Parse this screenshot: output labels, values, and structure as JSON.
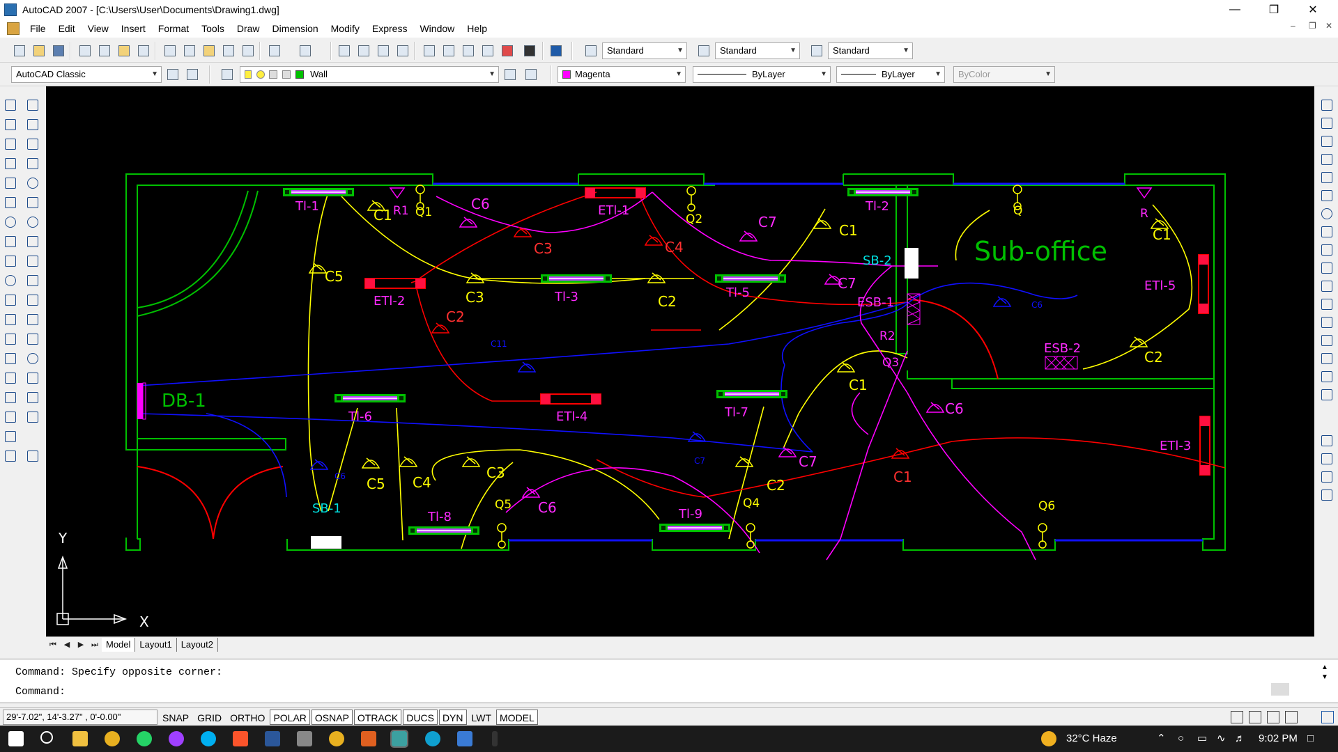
{
  "window": {
    "title": "AutoCAD 2007 - [C:\\Users\\User\\Documents\\Drawing1.dwg]",
    "minimize": "—",
    "restore": "❐",
    "close": "✕"
  },
  "menu": [
    "File",
    "Edit",
    "View",
    "Insert",
    "Format",
    "Tools",
    "Draw",
    "Dimension",
    "Modify",
    "Express",
    "Window",
    "Help"
  ],
  "toolbar1": {
    "text_style": "Standard",
    "dim_style": "Standard",
    "table_style": "Standard"
  },
  "toolbar2": {
    "workspace": "AutoCAD Classic",
    "layer": "Wall",
    "color": "Magenta",
    "linetype": "ByLayer",
    "lineweight": "ByLayer",
    "plotstyle": "ByColor"
  },
  "colors": {
    "wall": "#00c000",
    "yellow_wire": "#ffff00",
    "red_wire": "#ff0000",
    "blue_wire": "#1010ff",
    "magenta_wire": "#ff00ff",
    "label_magenta": "#ff2aff",
    "label_yellow": "#ffff00",
    "label_red": "#ff3030",
    "label_green": "#00c000",
    "label_cyan": "#00e0e0",
    "tube_body": "#c040ff",
    "canvas_bg": "#000000"
  },
  "drawing": {
    "room_label": "Sub-office",
    "db_label": "DB-1",
    "tubelights": [
      "Tl-1",
      "Tl-2",
      "Tl-3",
      "Tl-5",
      "Tl-6",
      "Tl-7",
      "Tl-8",
      "Tl-9"
    ],
    "etl_labels": [
      "ETl-1",
      "ETl-2",
      "ETl-3",
      "ETl-4",
      "ETl-5"
    ],
    "switchboards": [
      "SB-1",
      "SB-2"
    ],
    "esb_labels": [
      "ESB-1",
      "ESB-2"
    ],
    "q_labels": [
      "Q1",
      "Q2",
      "Q",
      "Q3",
      "Q4",
      "Q5",
      "Q6"
    ],
    "r_labels": [
      "R1",
      "R",
      "R2"
    ],
    "c_yellow": [
      "C1",
      "C1",
      "C1",
      "C1",
      "C2",
      "C2",
      "C2",
      "C3",
      "C3",
      "C4",
      "C5",
      "C5"
    ],
    "c_magenta": [
      "C6",
      "C7",
      "C7",
      "C6",
      "C6",
      "C7"
    ],
    "c_red": [
      "C2",
      "C3",
      "C4",
      "C1"
    ],
    "c_blue": [
      "C6",
      "C6",
      "C7",
      "C11"
    ]
  },
  "ucs": {
    "x": "X",
    "y": "Y"
  },
  "layout_tabs": [
    "Model",
    "Layout1",
    "Layout2"
  ],
  "layout_nav": [
    "⏮",
    "◀",
    "▶",
    "⏭"
  ],
  "command": {
    "history": "Command: Specify opposite corner:",
    "prompt": "Command:"
  },
  "status": {
    "coords": "29'-7.02\", 14'-3.27\" , 0'-0.00\"",
    "buttons": [
      {
        "label": "SNAP",
        "on": false
      },
      {
        "label": "GRID",
        "on": false
      },
      {
        "label": "ORTHO",
        "on": false
      },
      {
        "label": "POLAR",
        "on": true
      },
      {
        "label": "OSNAP",
        "on": true
      },
      {
        "label": "OTRACK",
        "on": true
      },
      {
        "label": "DUCS",
        "on": true
      },
      {
        "label": "DYN",
        "on": true
      },
      {
        "label": "LWT",
        "on": false
      },
      {
        "label": "MODEL",
        "on": true
      }
    ]
  },
  "taskbar": {
    "weather": "32°C  Haze",
    "time": "9:02 PM"
  }
}
